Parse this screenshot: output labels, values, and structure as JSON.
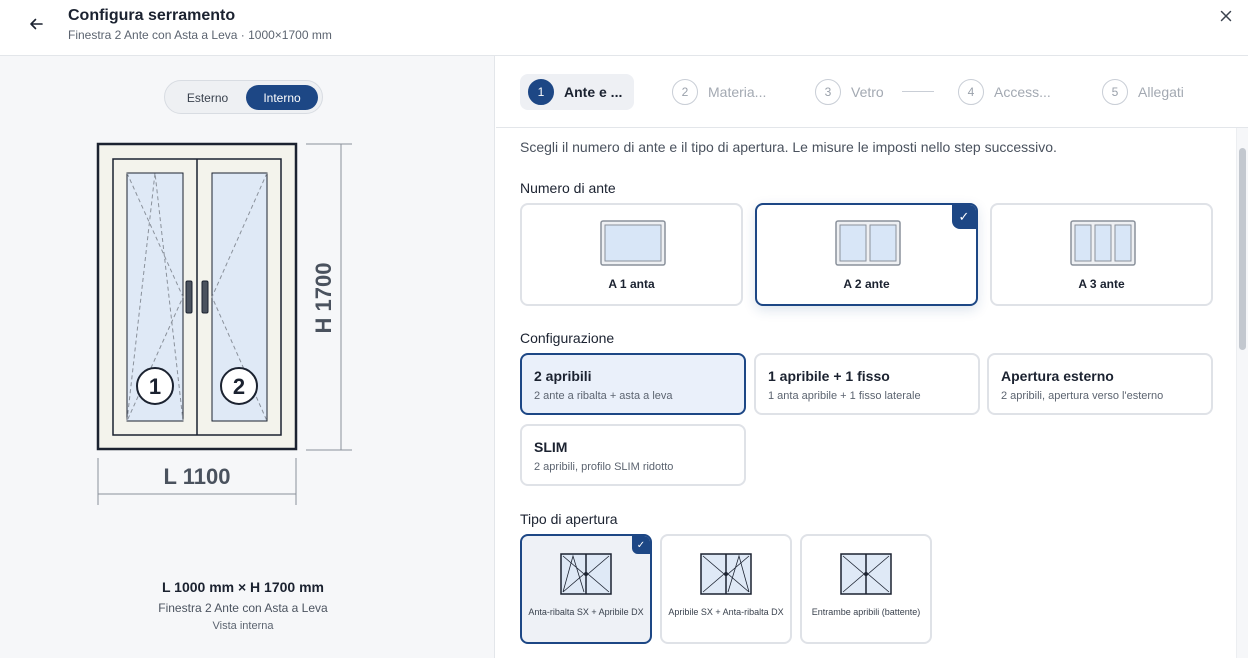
{
  "header": {
    "title": "Configura serramento",
    "subtitle": "Finestra 2 Ante con Asta a Leva · 1000×1700 mm"
  },
  "preview": {
    "toggle": {
      "external": "Esterno",
      "internal": "Interno",
      "selected": "Interno"
    },
    "height_label": "H 1700",
    "width_label": "L 1100",
    "sash_numbers": [
      "1",
      "2"
    ],
    "dimensions_text": "L 1000 mm × H 1700 mm",
    "product_name": "Finestra 2 Ante con Asta a Leva",
    "view_label": "Vista interna"
  },
  "stepper": {
    "steps": [
      {
        "num": "1",
        "label": "Ante e ...",
        "active": true
      },
      {
        "num": "2",
        "label": "Materia...",
        "active": false
      },
      {
        "num": "3",
        "label": "Vetro",
        "active": false
      },
      {
        "num": "4",
        "label": "Access...",
        "active": false
      },
      {
        "num": "5",
        "label": "Allegati",
        "active": false
      }
    ]
  },
  "content": {
    "intro": "Scegli il numero di ante e il tipo di apertura. Le misure le imposti nello step successivo.",
    "ante_section": {
      "label": "Numero di ante",
      "options": [
        {
          "label": "A 1 anta",
          "selected": false
        },
        {
          "label": "A 2 ante",
          "selected": true
        },
        {
          "label": "A 3 ante",
          "selected": false
        }
      ]
    },
    "config_section": {
      "label": "Configurazione",
      "options": [
        {
          "title": "2 apribili",
          "desc": "2 ante a ribalta + asta a leva",
          "selected": true
        },
        {
          "title": "1 apribile + 1 fisso",
          "desc": "1 anta apribile + 1 fisso laterale",
          "selected": false
        },
        {
          "title": "Apertura esterno",
          "desc": "2 apribili, apertura verso l'esterno",
          "selected": false
        },
        {
          "title": "SLIM",
          "desc": "2 apribili, profilo SLIM ridotto",
          "selected": false
        }
      ]
    },
    "tipo_section": {
      "label": "Tipo di apertura",
      "options": [
        {
          "label": "Anta-ribalta SX + Apribile DX",
          "selected": true
        },
        {
          "label": "Apribile SX + Anta-ribalta DX",
          "selected": false
        },
        {
          "label": "Entrambe apribili (battente)",
          "selected": false
        }
      ]
    },
    "check_glyph": "✓"
  },
  "colors": {
    "accent": "#1d4785",
    "glass": "#dfe9f6",
    "frame": "#1b2230",
    "frame_fill": "#f3f3ec"
  }
}
